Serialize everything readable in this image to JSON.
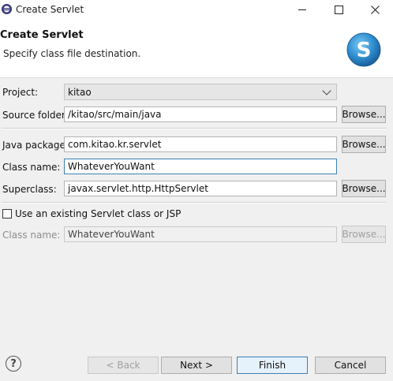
{
  "window": {
    "title": "Create Servlet",
    "controls": {
      "minimize": "minimize",
      "maximize": "maximize",
      "close": "close"
    }
  },
  "banner": {
    "title": "Create Servlet",
    "description": "Specify class file destination.",
    "logo_letter": "S"
  },
  "form": {
    "project": {
      "label": "Project:",
      "value": "kitao"
    },
    "source_folder": {
      "label": "Source folder:",
      "value": "/kitao/src/main/java",
      "button": "Browse..."
    },
    "java_package": {
      "label": "Java package:",
      "value": "com.kitao.kr.servlet",
      "button": "Browse..."
    },
    "class_name": {
      "label": "Class name:",
      "value": "WhateverYouWant"
    },
    "superclass": {
      "label": "Superclass:",
      "value": "javax.servlet.http.HttpServlet",
      "button": "Browse..."
    },
    "use_existing": {
      "label": "Use an existing Servlet class or JSP",
      "checked": false
    },
    "existing_class_name": {
      "label": "Class name:",
      "value": "WhateverYouWant",
      "button": "Browse..."
    }
  },
  "footer": {
    "help": "?",
    "back": "< Back",
    "next": "Next >",
    "finish": "Finish",
    "cancel": "Cancel"
  },
  "colors": {
    "accent": "#3c7fb1",
    "logo": "#2f8fd0"
  }
}
